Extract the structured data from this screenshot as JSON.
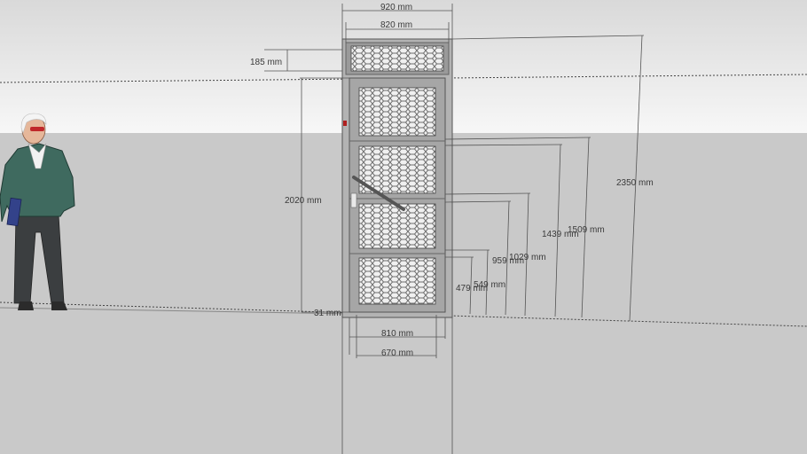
{
  "colors": {
    "sky_top": "#dcdcdc",
    "sky_bottom": "#f6f6f6",
    "ground": "#c9c9c9",
    "frame": "#a9a9a9",
    "mesh": "#8a8a8a",
    "jacket": "#3f6a5f",
    "dim_line": "#555555"
  },
  "dimensions": {
    "d920": "920 mm",
    "d820": "820 mm",
    "d185": "185 mm",
    "d2020": "2020 mm",
    "d2350": "2350 mm",
    "d1509": "1509 mm",
    "d1439": "1439 mm",
    "d1029": "1029 mm",
    "d959": "959 mm",
    "d549": "549 mm",
    "d479": "479 mm",
    "d31": "31 mm",
    "d810": "810 mm",
    "d670": "670 mm"
  },
  "scene": {
    "figure": "human-scale-figure",
    "object": "mesh-panel-door",
    "door_panels": 5,
    "icons": [
      "person-figure",
      "door-handle-icon",
      "lock-icon"
    ]
  }
}
